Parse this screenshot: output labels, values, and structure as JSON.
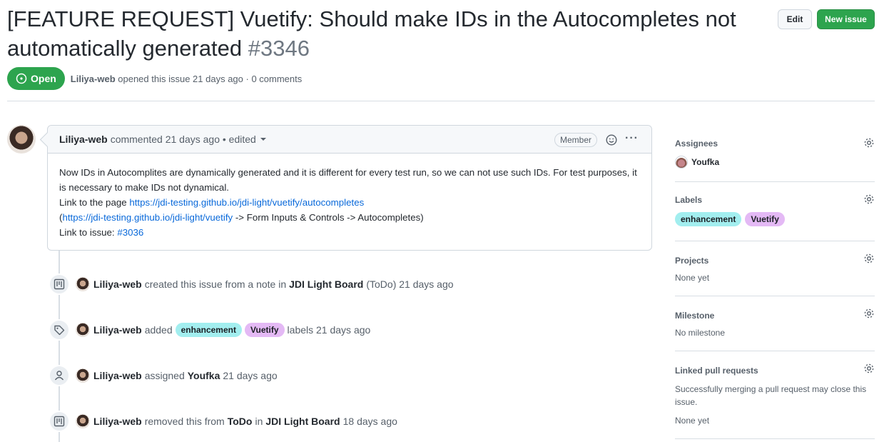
{
  "issue": {
    "title": "[FEATURE REQUEST] Vuetify: Should make IDs in the Autocompletes not automatically generated",
    "number": "#3346",
    "state": "Open",
    "author": "Liliya-web",
    "opened_text": "opened this issue 21 days ago · 0 comments"
  },
  "header": {
    "edit_label": "Edit",
    "new_issue_label": "New issue"
  },
  "comment": {
    "author": "Liliya-web",
    "meta": "commented 21 days ago • edited",
    "badge": "Member",
    "line1": "Now IDs in Autocomplites are dynamically generated and it is different for every test run, so we can not use such IDs. For test purposes, it is necessary to make IDs not dynamical.",
    "link_prefix": "Link to the page ",
    "link1": "https://jdi-testing.github.io/jdi-light/vuetify/autocompletes",
    "paren_open": "(",
    "link2": "https://jdi-testing.github.io/jdi-light/vuetify",
    "path_suffix": " -> Form Inputs & Controls -> Autocompletes)",
    "issue_prefix": "Link to issue: ",
    "issue_link": "#3036"
  },
  "timeline": [
    {
      "icon": "project-icon",
      "actor": "Liliya-web",
      "text1": "created this issue from a note in",
      "strong1": "JDI Light Board",
      "text2": "(ToDo) 21 days ago"
    },
    {
      "icon": "tag-icon",
      "actor": "Liliya-web",
      "text1": "added",
      "label1": "enhancement",
      "label2": "Vuetify",
      "text2": "labels 21 days ago"
    },
    {
      "icon": "person-icon",
      "actor": "Liliya-web",
      "text1": "assigned",
      "strong1": "Youfka",
      "text2": "21 days ago"
    },
    {
      "icon": "project-icon",
      "actor": "Liliya-web",
      "text1": "removed this from",
      "strong1": "ToDo",
      "text_in": "in",
      "strong2": "JDI Light Board",
      "text2": "18 days ago"
    }
  ],
  "sidebar": {
    "assignees": {
      "title": "Assignees",
      "name": "Youfka"
    },
    "labels": {
      "title": "Labels",
      "items": [
        "enhancement",
        "Vuetify"
      ]
    },
    "projects": {
      "title": "Projects",
      "value": "None yet"
    },
    "milestone": {
      "title": "Milestone",
      "value": "No milestone"
    },
    "linked": {
      "title": "Linked pull requests",
      "desc": "Successfully merging a pull request may close this issue.",
      "value": "None yet"
    }
  },
  "colors": {
    "open_green": "#2da44e",
    "link_blue": "#0969da",
    "label_enhancement": "#a2eeef",
    "label_vuetify": "#e4b9f5"
  }
}
